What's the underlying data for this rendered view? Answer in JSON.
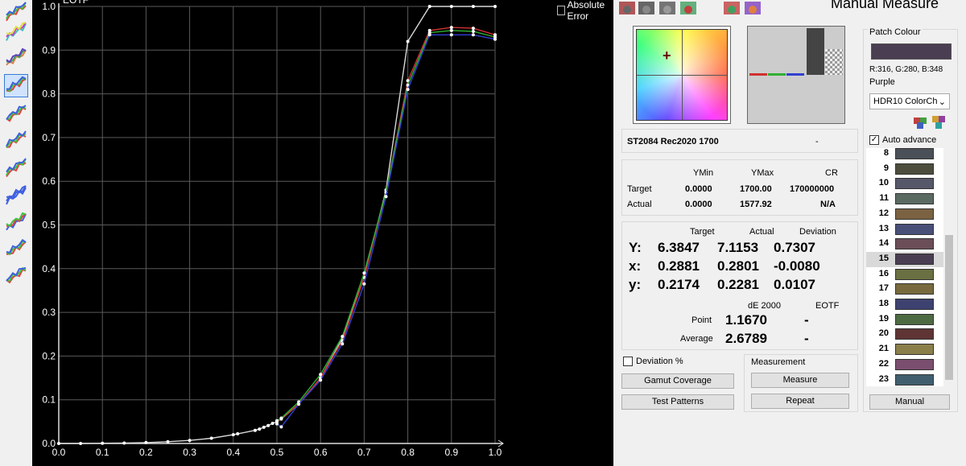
{
  "toolbar": {
    "icons": [
      "gamut-3d-icon",
      "gamut-triangle-icon",
      "gamut-cube-icon",
      "eotf-curve-icon",
      "rgb-balance-icon",
      "gamma-icon",
      "rgb-levels-icon",
      "luminance-icon",
      "delta-e-icon",
      "color-error-icon",
      "colorchecker-icon"
    ]
  },
  "chart": {
    "title": "EOTF",
    "absolute_error_label": "Absolute Error",
    "absolute_error_checked": false
  },
  "chart_data": {
    "type": "line",
    "title": "EOTF",
    "xlim": [
      0,
      1
    ],
    "ylim": [
      0,
      1
    ],
    "x_ticks": [
      "0.0",
      "0.1",
      "0.2",
      "0.3",
      "0.4",
      "0.5",
      "0.6",
      "0.7",
      "0.8",
      "0.9",
      "1.0"
    ],
    "y_ticks": [
      "0.0",
      "0.1",
      "0.2",
      "0.3",
      "0.4",
      "0.5",
      "0.6",
      "0.7",
      "0.8",
      "0.9",
      "1.0"
    ],
    "grid": true,
    "series": [
      {
        "color": "#d8d8d8",
        "x": [
          0.0,
          0.05,
          0.1,
          0.15,
          0.2,
          0.25,
          0.3,
          0.35,
          0.4,
          0.41,
          0.45,
          0.46,
          0.47,
          0.48,
          0.49,
          0.5,
          0.51,
          0.55,
          0.6,
          0.65,
          0.7,
          0.75,
          0.8,
          0.85,
          0.9,
          0.95,
          1.0
        ],
        "y": [
          0,
          0,
          0.0005,
          0.001,
          0.002,
          0.004,
          0.007,
          0.012,
          0.02,
          0.022,
          0.03,
          0.033,
          0.037,
          0.041,
          0.046,
          0.05,
          0.056,
          0.09,
          0.15,
          0.24,
          0.38,
          0.58,
          0.92,
          1.0,
          1.0,
          1.0,
          1.0
        ]
      },
      {
        "color": "#d03030",
        "x": [
          0.5,
          0.51,
          0.55,
          0.6,
          0.65,
          0.7,
          0.75,
          0.8,
          0.85,
          0.9,
          0.95,
          1.0
        ],
        "y": [
          0.05,
          0.057,
          0.09,
          0.15,
          0.235,
          0.38,
          0.575,
          0.83,
          0.945,
          0.952,
          0.95,
          0.935
        ]
      },
      {
        "color": "#30b030",
        "x": [
          0.5,
          0.51,
          0.55,
          0.6,
          0.65,
          0.7,
          0.75,
          0.8,
          0.85,
          0.9,
          0.95,
          1.0
        ],
        "y": [
          0.052,
          0.058,
          0.095,
          0.158,
          0.245,
          0.39,
          0.575,
          0.82,
          0.94,
          0.945,
          0.943,
          0.93
        ]
      },
      {
        "color": "#3040d0",
        "x": [
          0.5,
          0.51,
          0.55,
          0.6,
          0.65,
          0.7,
          0.75,
          0.8,
          0.85,
          0.9,
          0.95,
          1.0
        ],
        "y": [
          0.045,
          0.038,
          0.09,
          0.145,
          0.228,
          0.365,
          0.565,
          0.81,
          0.935,
          0.935,
          0.935,
          0.925
        ]
      }
    ]
  },
  "header": {
    "title": "Manual Measure",
    "icons": [
      "probe-icon",
      "tripod-icon",
      "pattern-gen-icon",
      "cube-settings-icon",
      "gamut-toggle-icon",
      "cube-view-icon"
    ]
  },
  "profile": {
    "name": "ST2084 Rec2020 1700",
    "value": "-"
  },
  "summary": {
    "col_ymin": "YMin",
    "col_ymax": "YMax",
    "col_cr": "CR",
    "target_label": "Target",
    "actual_label": "Actual",
    "target_ymin": "0.0000",
    "target_ymax": "1700.00",
    "target_cr": "170000000",
    "actual_ymin": "0.0000",
    "actual_ymax": "1577.92",
    "actual_cr": "N/A"
  },
  "measurement": {
    "col_target": "Target",
    "col_actual": "Actual",
    "col_deviation": "Deviation",
    "rows": [
      {
        "label": "Y:",
        "target": "6.3847",
        "actual": "7.1153",
        "deviation": "0.7307"
      },
      {
        "label": "x:",
        "target": "0.2881",
        "actual": "0.2801",
        "deviation": "-0.0080"
      },
      {
        "label": "y:",
        "target": "0.2174",
        "actual": "0.2281",
        "deviation": "0.0107"
      }
    ],
    "de_label": "dE 2000",
    "eotf_label": "EOTF",
    "point_label": "Point",
    "point_de": "1.1670",
    "point_eotf": "-",
    "average_label": "Average",
    "average_de": "2.6789",
    "average_eotf": "-"
  },
  "controls": {
    "deviation_pct_label": "Deviation %",
    "deviation_pct_checked": false,
    "gamut_coverage_label": "Gamut Coverage",
    "test_patterns_label": "Test Patterns",
    "measurement_group_label": "Measurement",
    "measure_label": "Measure",
    "repeat_label": "Repeat"
  },
  "patch": {
    "group_label": "Patch Colour",
    "swatch_color": "#4a3e52",
    "rgb_text": "R:316, G:280, B:348",
    "name": "Purple",
    "set_selected": "HDR10 ColorCh",
    "auto_advance_label": "Auto advance",
    "auto_advance_checked": true,
    "selected_index": "15",
    "list": [
      {
        "num": "8",
        "color": "#4b5058"
      },
      {
        "num": "9",
        "color": "#4d4d3e"
      },
      {
        "num": "10",
        "color": "#57576a"
      },
      {
        "num": "11",
        "color": "#5a6a62"
      },
      {
        "num": "12",
        "color": "#7a6242"
      },
      {
        "num": "13",
        "color": "#485078"
      },
      {
        "num": "14",
        "color": "#6a4e58"
      },
      {
        "num": "15",
        "color": "#4a3e52"
      },
      {
        "num": "16",
        "color": "#6a7042"
      },
      {
        "num": "17",
        "color": "#786a3e"
      },
      {
        "num": "18",
        "color": "#3e4270"
      },
      {
        "num": "19",
        "color": "#4e6a42"
      },
      {
        "num": "20",
        "color": "#5e3434"
      },
      {
        "num": "21",
        "color": "#8a7e4a"
      },
      {
        "num": "22",
        "color": "#7a4e6e"
      },
      {
        "num": "23",
        "color": "#405e6e"
      }
    ],
    "manual_label": "Manual"
  }
}
